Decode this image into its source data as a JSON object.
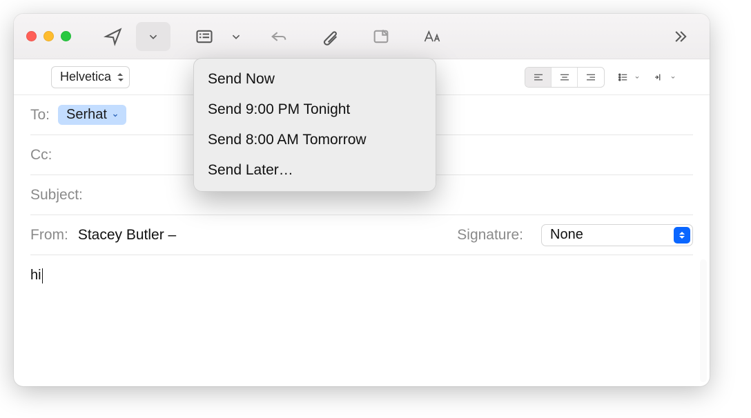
{
  "dropdown": {
    "items": [
      "Send Now",
      "Send 9:00 PM Tonight",
      "Send 8:00 AM Tomorrow",
      "Send Later…"
    ]
  },
  "format": {
    "font": "Helvetica"
  },
  "fields": {
    "to_label": "To:",
    "to_recipient": "Serhat",
    "cc_label": "Cc:",
    "subject_label": "Subject:",
    "from_label": "From:",
    "from_value": "Stacey Butler –",
    "signature_label": "Signature:",
    "signature_value": "None"
  },
  "body": {
    "text": "hi"
  }
}
